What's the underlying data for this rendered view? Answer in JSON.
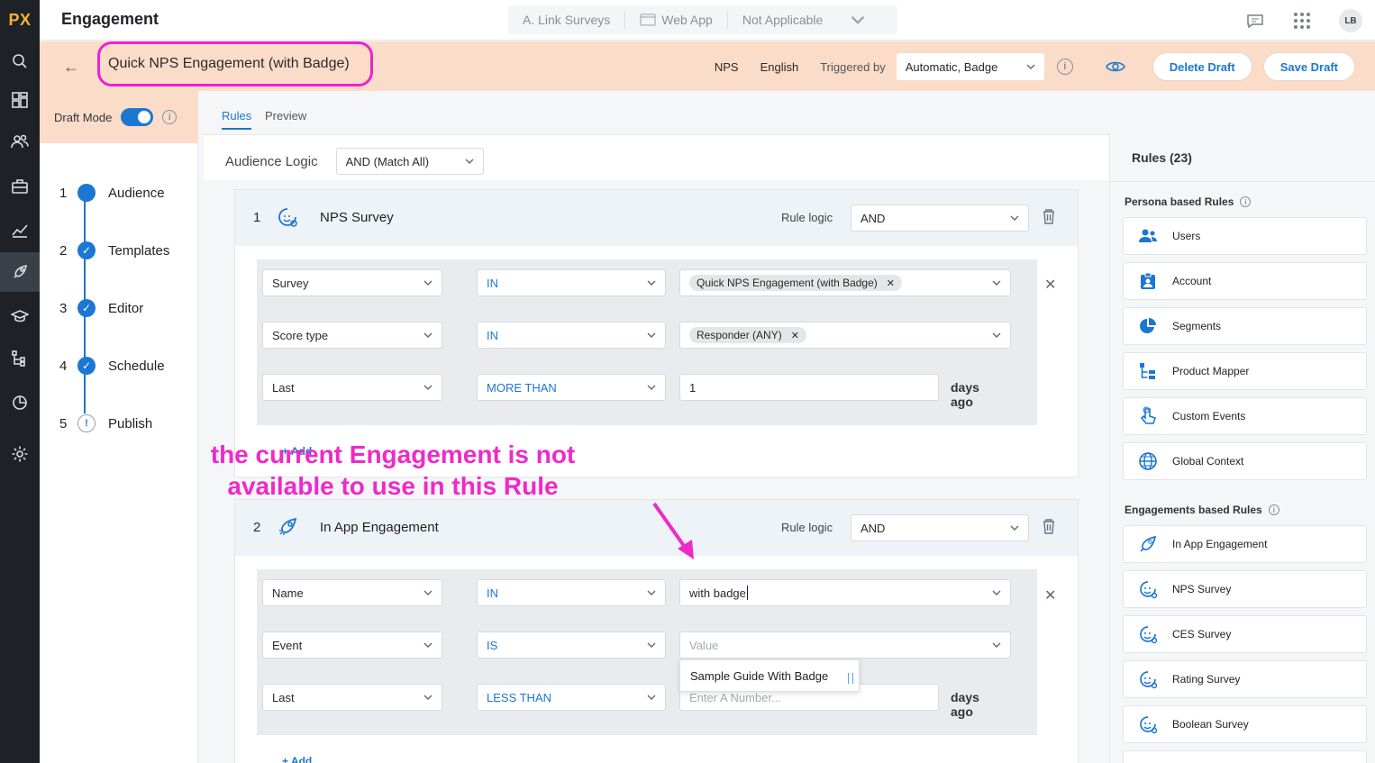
{
  "app": {
    "logo": "PX",
    "title": "Engagement",
    "avatar": "LB"
  },
  "context": {
    "product": "A. Link Surveys",
    "channel": "Web App",
    "environment": "Not Applicable"
  },
  "engagement": {
    "name": "Quick NPS Engagement (with Badge)",
    "type": "NPS",
    "language": "English",
    "triggered_by_label": "Triggered by",
    "triggered_by_value": "Automatic, Badge",
    "delete_label": "Delete Draft",
    "save_label": "Save Draft"
  },
  "draft_mode": {
    "label": "Draft Mode",
    "on": true
  },
  "steps": [
    {
      "num": "1",
      "label": "Audience",
      "state": "current"
    },
    {
      "num": "2",
      "label": "Templates",
      "state": "done"
    },
    {
      "num": "3",
      "label": "Editor",
      "state": "done"
    },
    {
      "num": "4",
      "label": "Schedule",
      "state": "done"
    },
    {
      "num": "5",
      "label": "Publish",
      "state": "warning"
    }
  ],
  "tabs": {
    "rules": "Rules",
    "preview": "Preview"
  },
  "audience_logic": {
    "label": "Audience Logic",
    "value": "AND (Match All)"
  },
  "rules": [
    {
      "num": "1",
      "name": "NPS Survey",
      "logic_label": "Rule logic",
      "logic_value": "AND",
      "conditions": [
        {
          "field": "Survey",
          "op": "IN",
          "chip": "Quick NPS Engagement (with Badge)"
        },
        {
          "field": "Score type",
          "op": "IN",
          "chip": "Responder (ANY)"
        },
        {
          "field": "Last",
          "op": "MORE THAN",
          "input": "1",
          "suffix": "days ago"
        }
      ],
      "add_label": "+ Add"
    },
    {
      "num": "2",
      "name": "In App Engagement",
      "logic_label": "Rule logic",
      "logic_value": "AND",
      "conditions": [
        {
          "field": "Name",
          "op": "IN",
          "typed": "with badge"
        },
        {
          "field": "Event",
          "op": "IS",
          "placeholder": "Value"
        },
        {
          "field": "Last",
          "op": "LESS THAN",
          "placeholder": "Enter A Number...",
          "suffix": "days ago"
        }
      ],
      "add_label": "+ Add",
      "suggestion": "Sample Guide With Badge"
    }
  ],
  "annotation": {
    "line1": "the current Engagement is not",
    "line2": "available to use in this Rule",
    "color": "#ee2ac9"
  },
  "rules_panel": {
    "title": "Rules (23)",
    "persona_title": "Persona based Rules",
    "persona": [
      "Users",
      "Account",
      "Segments",
      "Product Mapper",
      "Custom Events",
      "Global Context"
    ],
    "engagement_title": "Engagements based Rules",
    "engagement": [
      "In App Engagement",
      "NPS Survey",
      "CES Survey",
      "Rating Survey",
      "Boolean Survey"
    ]
  },
  "colors": {
    "accent": "#1b77d2",
    "header_bg": "#fbdcc9",
    "rail_bg": "#1e2226",
    "logo": "#f6b13a"
  }
}
